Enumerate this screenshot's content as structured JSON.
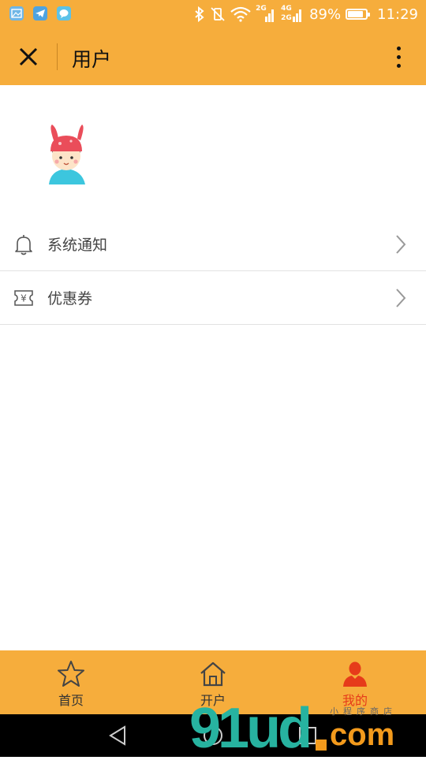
{
  "status_bar": {
    "net_top": "2G",
    "net_stack_top": "4G",
    "net_stack_bottom": "2G",
    "battery": "89%",
    "battery_level": 0.89,
    "time": "11:29"
  },
  "header": {
    "title": "用户"
  },
  "menu": {
    "items": [
      {
        "label": "系统通知",
        "icon": "bell-icon"
      },
      {
        "label": "优惠券",
        "icon": "coupon-icon"
      }
    ]
  },
  "tabs": [
    {
      "label": "首页",
      "icon": "star-icon",
      "active": false
    },
    {
      "label": "开户",
      "icon": "house-icon",
      "active": false
    },
    {
      "label": "我的",
      "icon": "person-icon",
      "active": true
    }
  ],
  "watermark": {
    "big": "91ud",
    "com": "com",
    "small": "小程序商店"
  },
  "colors": {
    "accent": "#f6ad3c",
    "active_tab": "#e63b1a"
  }
}
